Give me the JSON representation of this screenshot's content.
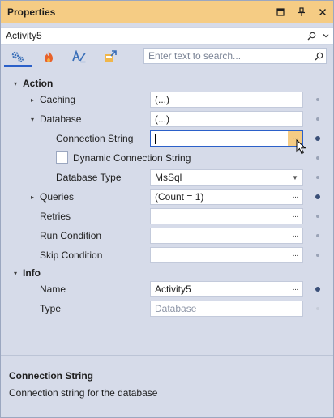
{
  "window": {
    "title": "Properties",
    "buttons": {
      "dropdown": "▾",
      "pin": "📌",
      "close": "✕"
    }
  },
  "object_selector": {
    "value": "Activity5"
  },
  "toolbar": {
    "tabs": [
      "categorized-icon",
      "events-icon",
      "alphabetical-icon",
      "custom-icon"
    ],
    "search_placeholder": "Enter text to search..."
  },
  "grid": {
    "categories": [
      {
        "label": "Action"
      },
      {
        "label": "Info"
      }
    ],
    "props": {
      "caching": {
        "label": "Caching",
        "value": "(...)"
      },
      "database": {
        "label": "Database",
        "value": "(...)"
      },
      "connection_string": {
        "label": "Connection String",
        "value": ""
      },
      "dynamic_connection_string": {
        "label": "Dynamic Connection String",
        "checked": false
      },
      "database_type": {
        "label": "Database Type",
        "value": "MsSql"
      },
      "queries": {
        "label": "Queries",
        "value": "(Count = 1)"
      },
      "retries": {
        "label": "Retries",
        "value": ""
      },
      "run_condition": {
        "label": "Run Condition",
        "value": ""
      },
      "skip_condition": {
        "label": "Skip Condition",
        "value": ""
      },
      "name": {
        "label": "Name",
        "value": "Activity5"
      },
      "type": {
        "label": "Type",
        "value": "Database"
      }
    }
  },
  "description": {
    "title": "Connection String",
    "text": "Connection string for the database"
  },
  "colors": {
    "titlebar": "#f5cc84",
    "panel": "#d6dbe9",
    "accent": "#2b60c9"
  }
}
